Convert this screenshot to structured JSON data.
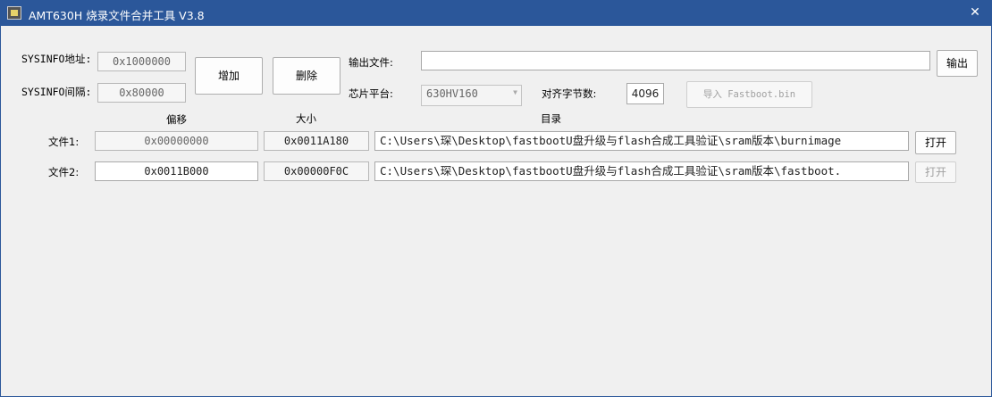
{
  "window": {
    "title": "AMT630H 烧录文件合并工具 V3.8",
    "close_glyph": "✕"
  },
  "sysinfo": {
    "addr_label": "SYSINFO地址:",
    "addr_value": "0x1000000",
    "interval_label": "SYSINFO间隔:",
    "interval_value": "0x80000"
  },
  "buttons": {
    "add": "增加",
    "delete": "删除",
    "output": "输出",
    "import": "导入 Fastboot.bin"
  },
  "output": {
    "label": "输出文件:",
    "value": ""
  },
  "chip": {
    "label": "芯片平台:",
    "value": "630HV160",
    "arrow": "▼"
  },
  "align": {
    "label": "对齐字节数:",
    "value": "4096"
  },
  "columns": {
    "offset": "偏移",
    "size": "大小",
    "dir": "目录"
  },
  "files": [
    {
      "label": "文件1:",
      "offset": "0x00000000",
      "size": "0x0011A180",
      "path": "C:\\Users\\琛\\Desktop\\fastbootU盘升级与flash合成工具验证\\sram版本\\burnimage",
      "open": "打开"
    },
    {
      "label": "文件2:",
      "offset": "0x0011B000",
      "size": "0x00000F0C",
      "path": "C:\\Users\\琛\\Desktop\\fastbootU盘升级与flash合成工具验证\\sram版本\\fastboot.",
      "open": "打开"
    }
  ],
  "colors": {
    "titlebar": "#2b579a",
    "window_bg": "#f0f0f0"
  }
}
